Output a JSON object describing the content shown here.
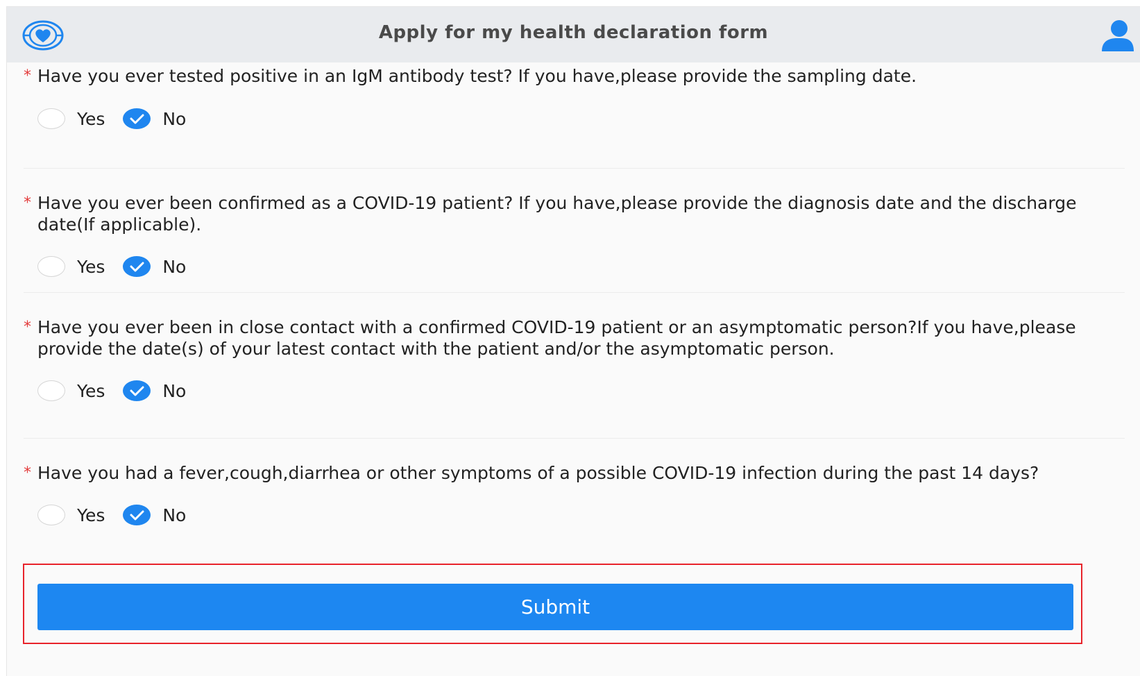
{
  "header": {
    "title": "Apply for my health declaration form",
    "logo_icon": "heart-shield-icon",
    "user_icon": "user-icon"
  },
  "questions": [
    {
      "required_mark": "*",
      "text": "Have you ever tested positive in an IgM antibody test? If you have,please provide the sampling date.",
      "options": [
        "Yes",
        "No"
      ],
      "selected": "No"
    },
    {
      "required_mark": "*",
      "text": "Have you ever been confirmed as a COVID-19 patient? If you have,please provide the diagnosis date and the discharge date(If applicable).",
      "options": [
        "Yes",
        "No"
      ],
      "selected": "No"
    },
    {
      "required_mark": "*",
      "text": "Have you ever been in close contact with a confirmed COVID-19 patient or an asymptomatic person?If you have,please provide the date(s) of your latest contact with the patient and/or the asymptomatic person.",
      "options": [
        "Yes",
        "No"
      ],
      "selected": "No"
    },
    {
      "required_mark": "*",
      "text": "Have you had a fever,cough,diarrhea or other symptoms of a possible COVID-19 infection during the past 14 days?",
      "options": [
        "Yes",
        "No"
      ],
      "selected": "No"
    }
  ],
  "submit": {
    "label": "Submit"
  },
  "colors": {
    "accent": "#1d87f1",
    "required": "#e33b3b",
    "highlight_border": "#e8232b",
    "header_bg": "#e9ebee"
  }
}
